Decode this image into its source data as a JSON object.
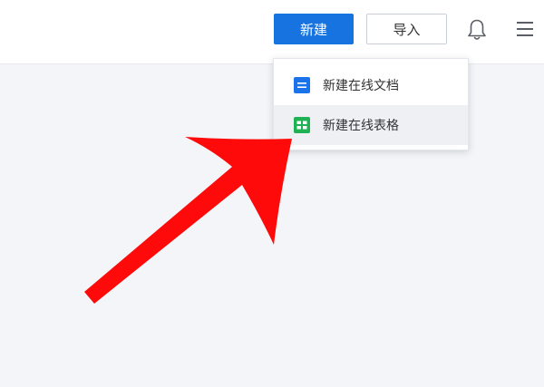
{
  "header": {
    "new_label": "新建",
    "import_label": "导入",
    "icons": [
      "bell-icon",
      "menu-icon"
    ]
  },
  "dropdown": {
    "items": [
      {
        "label": "新建在线文档",
        "icon": "doc-icon",
        "color": "#1a73e8"
      },
      {
        "label": "新建在线表格",
        "icon": "sheet-icon",
        "color": "#1eb254"
      }
    ]
  },
  "colors": {
    "accent": "#1773e0",
    "arrow": "#ff0a0a",
    "background": "#f3f5f9"
  }
}
